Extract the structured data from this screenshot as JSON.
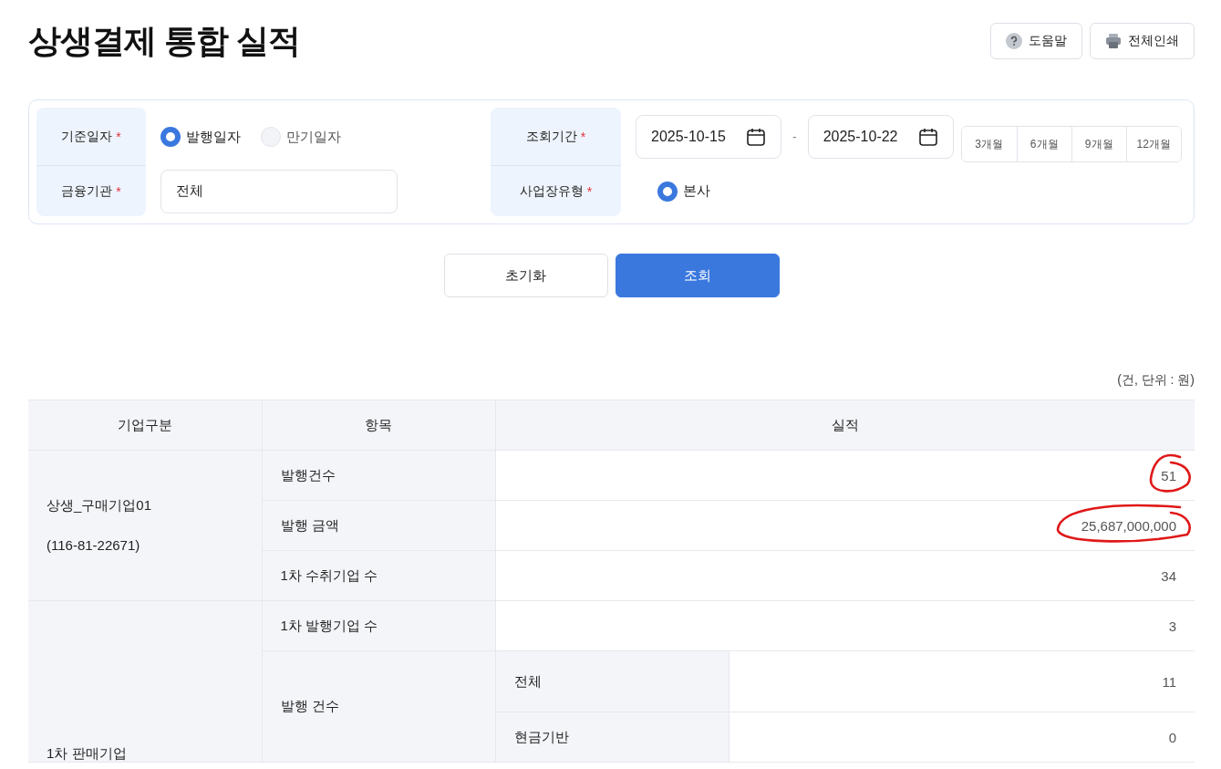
{
  "page": {
    "title": "상생결제 통합 실적",
    "actions": [
      {
        "kind": "help",
        "label": "도움말"
      },
      {
        "kind": "print",
        "label": "전체인쇄"
      }
    ]
  },
  "filters": {
    "base_date": {
      "label": "기준일자",
      "required_mark": "*",
      "options": [
        {
          "label": "발행일자",
          "selected": true
        },
        {
          "label": "만기일자",
          "selected": false
        }
      ]
    },
    "period": {
      "label": "조회기간",
      "required_mark": "*",
      "from": "2025-10-15",
      "separator": "-",
      "to": "2025-10-22",
      "presets": [
        "3개월",
        "6개월",
        "9개월",
        "12개월"
      ]
    },
    "institution": {
      "label": "금융기관",
      "required_mark": "*",
      "value": "전체"
    },
    "site_type": {
      "label": "사업장유형",
      "required_mark": "*",
      "options": [
        {
          "label": "본사",
          "selected": true
        }
      ]
    }
  },
  "buttons": [
    {
      "kind": "secondary",
      "label": "초기화"
    },
    {
      "kind": "primary",
      "label": "조회"
    }
  ],
  "unit_note": "(건, 단위 : 원)",
  "table": {
    "columns": [
      "기업구분",
      "항목",
      "실적"
    ],
    "groups": [
      {
        "company": [
          "상생_구매기업01",
          "(116-81-22671)"
        ],
        "items": [
          {
            "label": "발행건수",
            "value": "51",
            "circled": true
          },
          {
            "label": "발행 금액",
            "value": "25,687,000,000",
            "circled": true
          },
          {
            "label": "1차 수취기업 수",
            "value": "34",
            "circled": false
          }
        ]
      },
      {
        "company": [
          "1차 판매기업"
        ],
        "items": [
          {
            "label": "1차 발행기업 수",
            "value": "3",
            "circled": false
          },
          {
            "label": "발행 건수",
            "subitems": [
              {
                "label": "전체",
                "value": "11",
                "circled": false
              },
              {
                "label": "현금기반",
                "value": "0",
                "circled": false
              }
            ]
          }
        ]
      }
    ]
  }
}
